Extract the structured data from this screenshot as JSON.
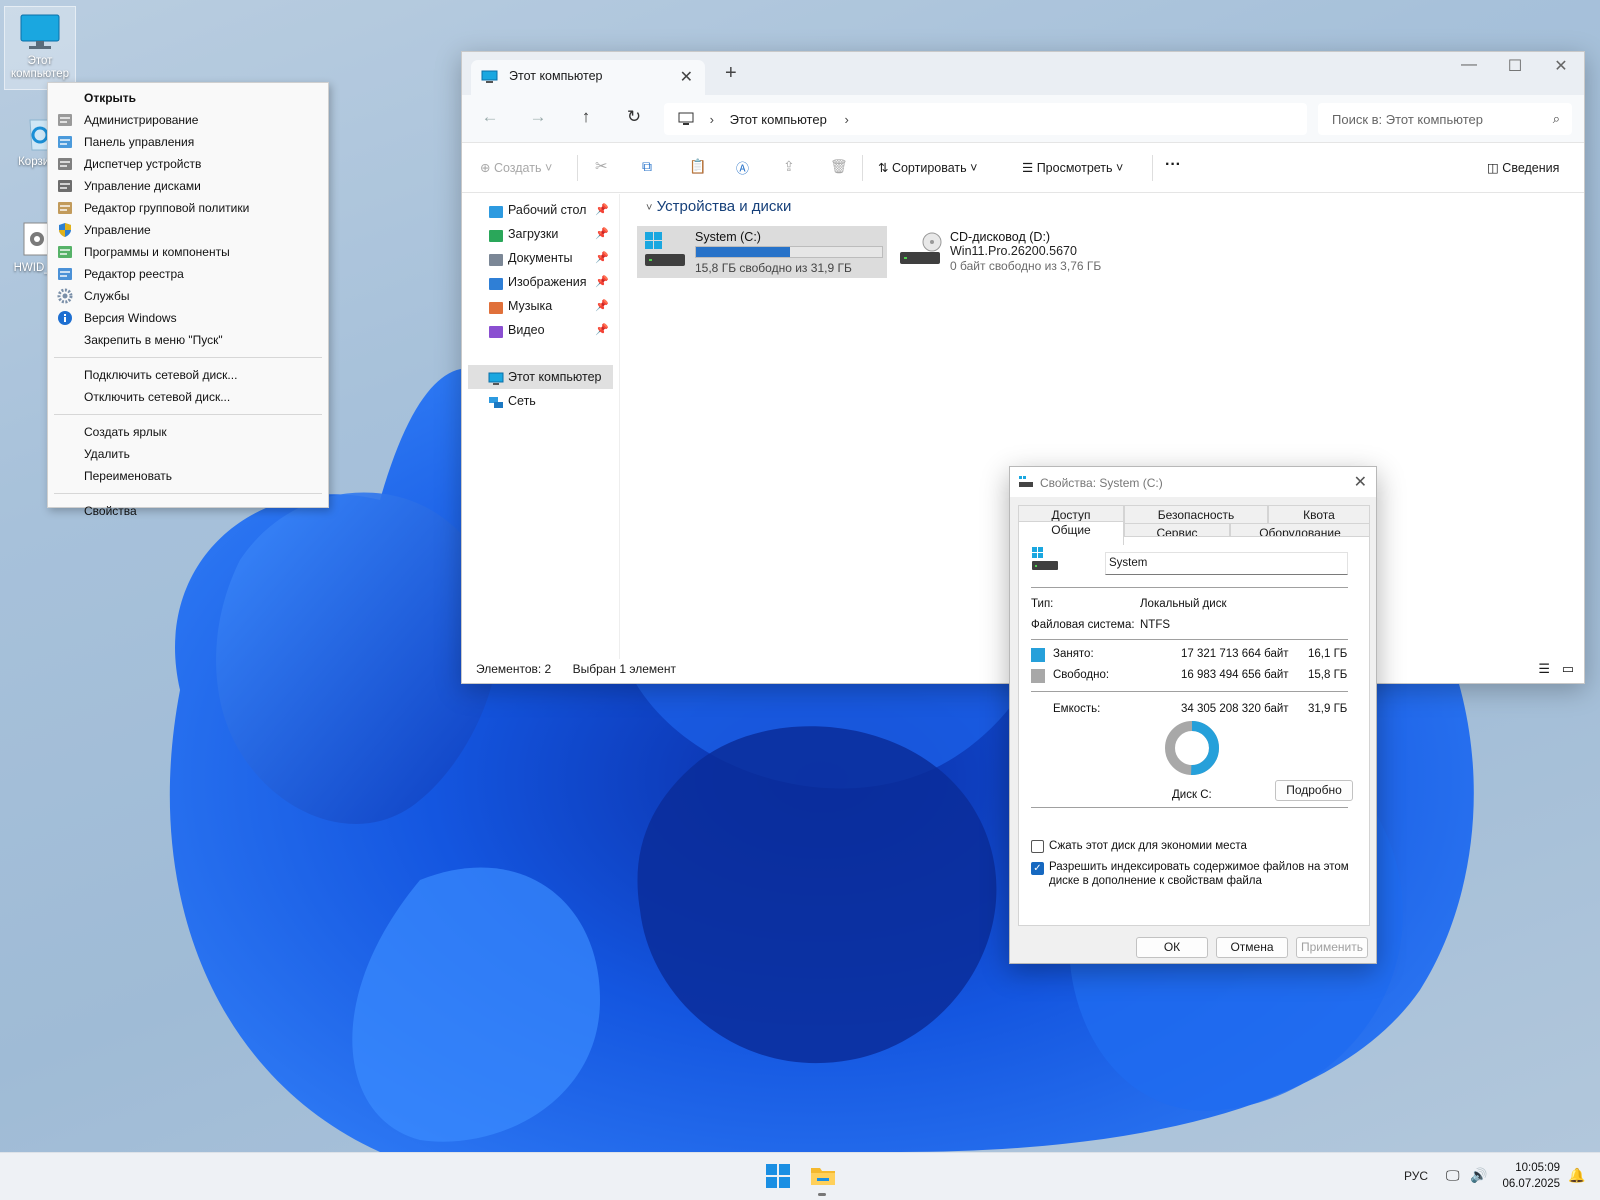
{
  "desktop": {
    "icons": [
      {
        "label": "Этот компьютер"
      },
      {
        "label": "Корзина"
      },
      {
        "label": "HWID_A"
      }
    ]
  },
  "context_menu": {
    "items": [
      {
        "label": "Открыть",
        "icon": "none",
        "bold": true
      },
      {
        "label": "Администрирование",
        "icon": "admin-tools-icon"
      },
      {
        "label": "Панель управления",
        "icon": "control-panel-icon"
      },
      {
        "label": "Диспетчер устройств",
        "icon": "device-manager-icon"
      },
      {
        "label": "Управление дисками",
        "icon": "disk-management-icon"
      },
      {
        "label": "Редактор групповой политики",
        "icon": "group-policy-icon"
      },
      {
        "label": "Управление",
        "icon": "shield-icon"
      },
      {
        "label": "Программы и компоненты",
        "icon": "programs-icon"
      },
      {
        "label": "Редактор реестра",
        "icon": "registry-icon"
      },
      {
        "label": "Службы",
        "icon": "services-gear-icon"
      },
      {
        "label": "Версия Windows",
        "icon": "info-icon"
      },
      {
        "label": "Закрепить в меню \"Пуск\"",
        "icon": "none"
      }
    ],
    "items2": [
      {
        "label": "Подключить сетевой диск..."
      },
      {
        "label": "Отключить сетевой диск..."
      }
    ],
    "items3": [
      {
        "label": "Создать ярлык"
      },
      {
        "label": "Удалить"
      },
      {
        "label": "Переименовать"
      }
    ],
    "items4": [
      {
        "label": "Свойства"
      }
    ]
  },
  "explorer": {
    "tab_title": "Этот компьютер",
    "breadcrumb": "Этот компьютер",
    "search_placeholder": "Поиск в: Этот компьютер",
    "commands": {
      "create": "Создать",
      "sort": "Сортировать",
      "view": "Просмотреть",
      "details": "Сведения"
    },
    "nav": {
      "quick": [
        {
          "label": "Рабочий стол",
          "icon": "desktop-icon"
        },
        {
          "label": "Загрузки",
          "icon": "downloads-icon"
        },
        {
          "label": "Документы",
          "icon": "documents-icon"
        },
        {
          "label": "Изображения",
          "icon": "pictures-icon"
        },
        {
          "label": "Музыка",
          "icon": "music-icon"
        },
        {
          "label": "Видео",
          "icon": "video-icon"
        }
      ],
      "this_pc": "Этот компьютер",
      "network": "Сеть"
    },
    "group_title": "Устройства и диски",
    "drives": [
      {
        "name": "System (C:)",
        "free_text": "15,8 ГБ свободно из 31,9 ГБ",
        "used_fraction": 0.505
      },
      {
        "name": "CD-дисковод (D:)",
        "label": "Win11.Pro.26200.5670",
        "free_text": "0 байт свободно из 3,76 ГБ"
      }
    ],
    "status": {
      "items": "Элементов: 2",
      "selected": "Выбран 1 элемент"
    },
    "accent": "#2672c9"
  },
  "properties": {
    "title": "Свойства: System (C:)",
    "tabs_row1": [
      "Доступ",
      "Безопасность",
      "Квота"
    ],
    "tabs_row2": [
      "Общие",
      "Сервис",
      "Оборудование"
    ],
    "volume_name": "System",
    "type_label": "Тип:",
    "type_value": "Локальный диск",
    "fs_label": "Файловая система:",
    "fs_value": "NTFS",
    "used_label": "Занято:",
    "used_bytes": "17 321 713 664 байт",
    "used_gb": "16,1 ГБ",
    "free_label": "Свободно:",
    "free_bytes": "16 983 494 656 байт",
    "free_gb": "15,8 ГБ",
    "capacity_label": "Емкость:",
    "capacity_bytes": "34 305 208 320 байт",
    "capacity_gb": "31,9 ГБ",
    "disk_label": "Диск C:",
    "details_button": "Подробно",
    "compress_label": "Сжать этот диск для экономии места",
    "compress_checked": false,
    "index_label_1": "Разрешить индексировать содержимое файлов на этом",
    "index_label_2": "диске в дополнение к свойствам файла",
    "index_checked": true,
    "ok": "ОК",
    "cancel": "Отмена",
    "apply": "Применить",
    "used_color": "#26a0da",
    "free_color": "#a8a8a8",
    "used_fraction": 0.505
  },
  "taskbar": {
    "lang": "РУС",
    "time": "10:05:09",
    "date": "06.07.2025"
  }
}
